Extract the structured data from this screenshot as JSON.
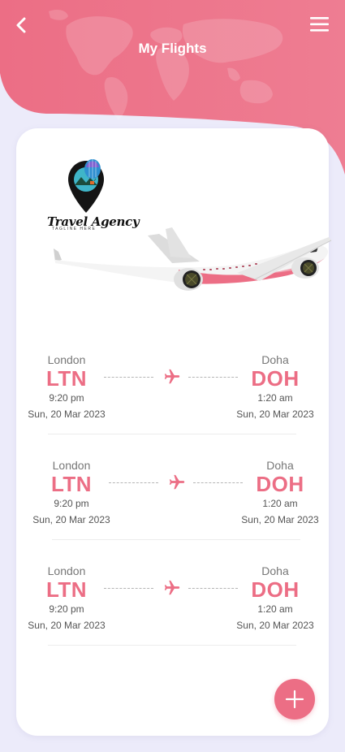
{
  "header": {
    "title": "My Flights",
    "accent_color": "#ec6e85",
    "back_icon": "chevron-left-icon",
    "menu_icon": "hamburger-menu-icon"
  },
  "brand": {
    "name": "Travel Agency",
    "tagline": "TAGLINE HERE"
  },
  "flights": [
    {
      "origin": {
        "city": "London",
        "code": "LTN",
        "time": "9:20 pm",
        "date": "Sun, 20 Mar 2023"
      },
      "destination": {
        "city": "Doha",
        "code": "DOH",
        "time": "1:20 am",
        "date": "Sun, 20 Mar 2023"
      }
    },
    {
      "origin": {
        "city": "London",
        "code": "LTN",
        "time": "9:20 pm",
        "date": "Sun, 20 Mar 2023"
      },
      "destination": {
        "city": "Doha",
        "code": "DOH",
        "time": "1:20 am",
        "date": "Sun, 20 Mar 2023"
      }
    },
    {
      "origin": {
        "city": "London",
        "code": "LTN",
        "time": "9:20 pm",
        "date": "Sun, 20 Mar 2023"
      },
      "destination": {
        "city": "Doha",
        "code": "DOH",
        "time": "1:20 am",
        "date": "Sun, 20 Mar 2023"
      }
    }
  ],
  "fab": {
    "icon": "plus-icon"
  }
}
